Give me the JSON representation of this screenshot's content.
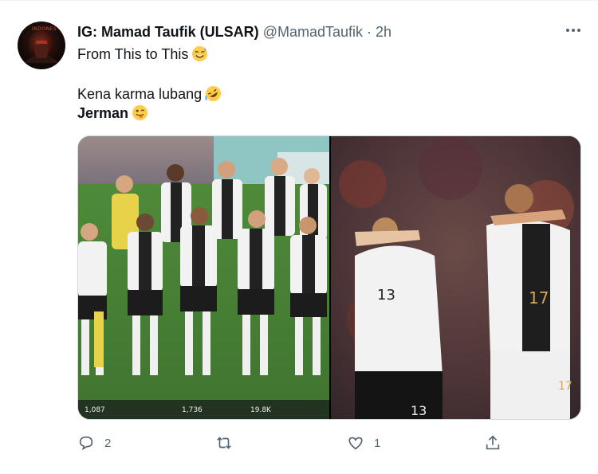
{
  "tweet": {
    "author_name": "IG: Mamad Taufik (ULSAR)",
    "handle": "@MamadTaufik",
    "separator": "·",
    "time": "2h",
    "lines": [
      {
        "text": "From This to This",
        "emoji": "sweat-smile-emoji"
      },
      {
        "text": "Kena karma lubang",
        "emoji": "rofl-emoji"
      },
      {
        "text": "Jerman",
        "emoji": "wink-tongue-emoji"
      }
    ],
    "avatar_label": "INDONES"
  },
  "media": {
    "left_photo_stats": {
      "replies": "1,087",
      "retweets": "1,736",
      "likes": "19.8K"
    }
  },
  "actions": {
    "reply_count": "2",
    "retweet_count": "",
    "like_count": "1"
  }
}
